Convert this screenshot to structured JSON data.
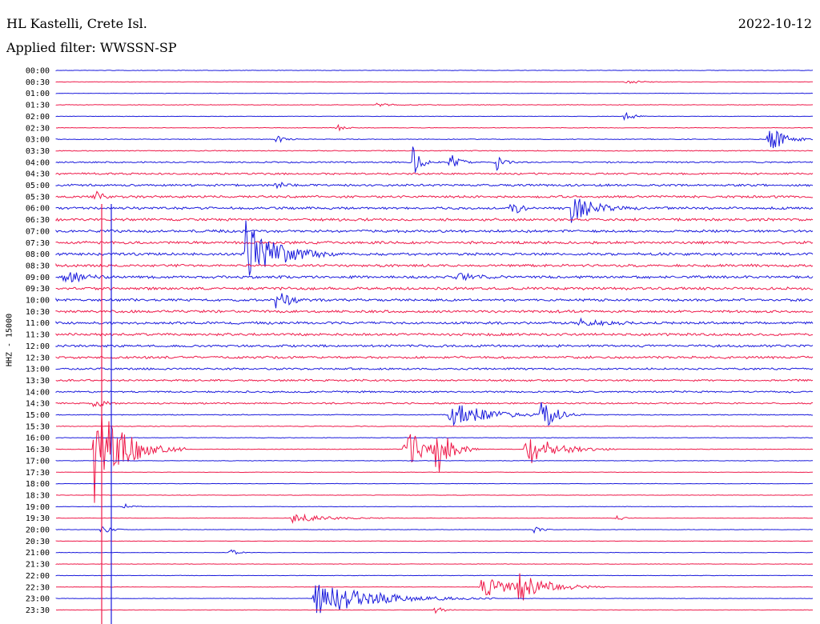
{
  "header": {
    "station": "HL Kastelli, Crete Isl.",
    "date": "2022-10-12",
    "filter": "Applied filter: WWSSN-SP"
  },
  "chart_data": {
    "type": "line",
    "title": "HL Kastelli, Crete Isl.",
    "subtitle": "Applied filter: WWSSN-SP",
    "ylabel": "HHZ - 15000",
    "xlabel": "",
    "grid": false,
    "colors": {
      "odd": "#1a1adc",
      "even": "#ee1a4a"
    },
    "time_labels": [
      "00:00",
      "00:30",
      "01:00",
      "01:30",
      "02:00",
      "02:30",
      "03:00",
      "03:30",
      "04:00",
      "04:30",
      "05:00",
      "05:30",
      "06:00",
      "06:30",
      "07:00",
      "07:30",
      "08:00",
      "08:30",
      "09:00",
      "09:30",
      "10:00",
      "10:30",
      "11:00",
      "11:30",
      "12:00",
      "12:30",
      "13:00",
      "13:30",
      "14:00",
      "14:30",
      "15:00",
      "15:30",
      "16:00",
      "16:30",
      "17:00",
      "17:30",
      "18:00",
      "18:30",
      "19:00",
      "19:30",
      "20:00",
      "20:30",
      "21:00",
      "21:30",
      "22:00",
      "22:30",
      "23:00",
      "23:30"
    ],
    "noise_level": [
      0.3,
      0.3,
      0.3,
      0.4,
      0.3,
      0.4,
      0.5,
      0.6,
      1.0,
      1.3,
      1.5,
      1.6,
      1.7,
      1.8,
      1.8,
      1.8,
      1.8,
      1.8,
      1.8,
      1.8,
      1.7,
      1.7,
      1.7,
      1.7,
      1.6,
      1.6,
      1.4,
      1.3,
      1.2,
      1.0,
      0.6,
      0.5,
      0.4,
      0.4,
      0.4,
      0.3,
      0.3,
      0.3,
      0.3,
      0.3,
      0.3,
      0.3,
      0.3,
      0.3,
      0.3,
      0.3,
      0.3,
      0.3
    ],
    "events": [
      {
        "row": 1,
        "t": 0.75,
        "amp": 2,
        "dur": 0.03
      },
      {
        "row": 3,
        "t": 0.42,
        "amp": 2,
        "dur": 0.03
      },
      {
        "row": 4,
        "t": 0.75,
        "amp": 10,
        "dur": 0.01
      },
      {
        "row": 5,
        "t": 0.37,
        "amp": 5,
        "dur": 0.01
      },
      {
        "row": 6,
        "t": 0.29,
        "amp": 6,
        "dur": 0.01
      },
      {
        "row": 6,
        "t": 0.94,
        "amp": 20,
        "dur": 0.02
      },
      {
        "row": 8,
        "t": 0.47,
        "amp": 25,
        "dur": 0.01
      },
      {
        "row": 8,
        "t": 0.52,
        "amp": 16,
        "dur": 0.01
      },
      {
        "row": 8,
        "t": 0.58,
        "amp": 12,
        "dur": 0.01
      },
      {
        "row": 10,
        "t": 0.29,
        "amp": 6,
        "dur": 0.01
      },
      {
        "row": 11,
        "t": 0.05,
        "amp": 10,
        "dur": 0.01
      },
      {
        "row": 12,
        "t": 0.6,
        "amp": 14,
        "dur": 0.01
      },
      {
        "row": 12,
        "t": 0.68,
        "amp": 18,
        "dur": 0.03
      },
      {
        "row": 16,
        "t": 0.25,
        "amp": 45,
        "dur": 0.04
      },
      {
        "row": 18,
        "t": 0.01,
        "amp": 12,
        "dur": 0.02
      },
      {
        "row": 18,
        "t": 0.53,
        "amp": 6,
        "dur": 0.02
      },
      {
        "row": 20,
        "t": 0.29,
        "amp": 12,
        "dur": 0.02
      },
      {
        "row": 22,
        "t": 0.69,
        "amp": 5,
        "dur": 0.03
      },
      {
        "row": 29,
        "t": 0.05,
        "amp": 12,
        "dur": 0.01
      },
      {
        "row": 30,
        "t": 0.52,
        "amp": 18,
        "dur": 0.05
      },
      {
        "row": 30,
        "t": 0.64,
        "amp": 22,
        "dur": 0.02
      },
      {
        "row": 33,
        "t": 0.46,
        "amp": 30,
        "dur": 0.03
      },
      {
        "row": 33,
        "t": 0.5,
        "amp": 35,
        "dur": 0.02
      },
      {
        "row": 33,
        "t": 0.62,
        "amp": 22,
        "dur": 0.04
      },
      {
        "row": 33,
        "t": 0.05,
        "amp": 70,
        "dur": 0.04
      },
      {
        "row": 38,
        "t": 0.09,
        "amp": 5,
        "dur": 0.01
      },
      {
        "row": 39,
        "t": 0.31,
        "amp": 6,
        "dur": 0.05
      },
      {
        "row": 39,
        "t": 0.74,
        "amp": 4,
        "dur": 0.01
      },
      {
        "row": 40,
        "t": 0.06,
        "amp": 8,
        "dur": 0.01
      },
      {
        "row": 40,
        "t": 0.63,
        "amp": 6,
        "dur": 0.01
      },
      {
        "row": 42,
        "t": 0.23,
        "amp": 6,
        "dur": 0.01
      },
      {
        "row": 45,
        "t": 0.56,
        "amp": 14,
        "dur": 0.05
      },
      {
        "row": 45,
        "t": 0.61,
        "amp": 16,
        "dur": 0.04
      },
      {
        "row": 46,
        "t": 0.34,
        "amp": 24,
        "dur": 0.08
      },
      {
        "row": 47,
        "t": 0.5,
        "amp": 8,
        "dur": 0.01
      }
    ]
  }
}
